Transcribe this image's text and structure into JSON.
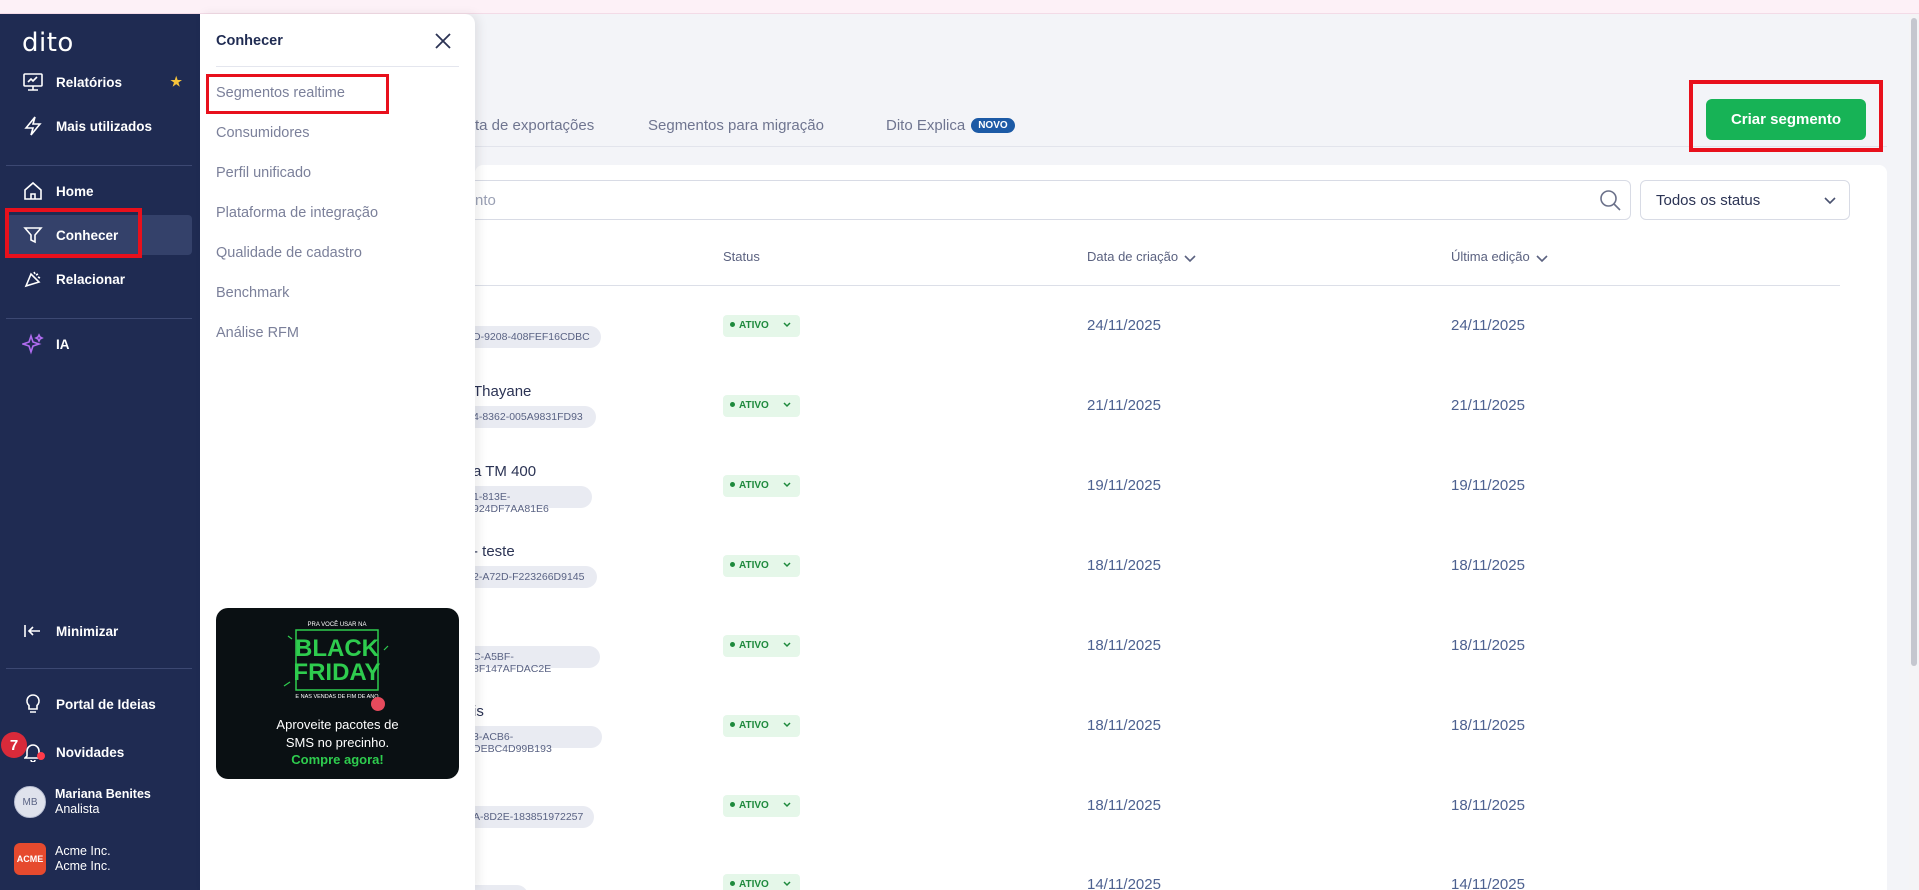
{
  "sidebar": {
    "logo": "dito",
    "items": [
      {
        "label": "Relatórios",
        "icon": "report-icon"
      },
      {
        "label": "Mais utilizados",
        "icon": "lightning-icon"
      },
      {
        "label": "Home",
        "icon": "home-icon"
      },
      {
        "label": "Conhecer",
        "icon": "filter-icon"
      },
      {
        "label": "Relacionar",
        "icon": "megaphone-icon"
      },
      {
        "label": "IA",
        "icon": "sparkles-icon"
      }
    ],
    "bottom": [
      {
        "label": "Minimizar",
        "icon": "collapse-icon"
      },
      {
        "label": "Portal de Ideias",
        "icon": "lightbulb-icon"
      },
      {
        "label": "Novidades",
        "icon": "bell-icon"
      }
    ],
    "notification_count": "7",
    "user": {
      "initials": "MB",
      "name": "Mariana Benites",
      "role": "Analista"
    },
    "account": {
      "logo_text": "ACME",
      "name": "Acme Inc.",
      "sub": "Acme Inc."
    }
  },
  "flyout": {
    "title": "Conhecer",
    "items": [
      "Segmentos realtime",
      "Consumidores",
      "Perfil unificado",
      "Plataforma de integração",
      "Qualidade de cadastro",
      "Benchmark",
      "Análise RFM"
    ],
    "promo": {
      "small": "PRA VOCÊ USAR NA",
      "big1": "BLACK",
      "big2": "FRIDAY",
      "sub": "E NAS VENDAS DE FIM DE ANO",
      "line1": "Aproveite pacotes de",
      "line2": "SMS no precinho.",
      "cta": "Compre agora!"
    }
  },
  "tabs": [
    {
      "label": "ta de exportações"
    },
    {
      "label": "Segmentos para migração"
    },
    {
      "label": "Dito Explica",
      "badge": "NOVO"
    }
  ],
  "create_button": "Criar segmento",
  "search": {
    "placeholder": "nto"
  },
  "status_filter": "Todos os status",
  "table": {
    "headers": {
      "status": "Status",
      "created": "Data de criação",
      "edited": "Última edição"
    },
    "rows": [
      {
        "name": "",
        "id": "D-9208-408FEF16CDBC",
        "status": "ATIVO",
        "created": "24/11/2025",
        "edited": "24/11/2025"
      },
      {
        "name": "Thayane",
        "id": "4-8362-005A9831FD93",
        "status": "ATIVO",
        "created": "21/11/2025",
        "edited": "21/11/2025"
      },
      {
        "name": "a TM 400",
        "id": "1-813E-924DF7AA81E6",
        "status": "ATIVO",
        "created": "19/11/2025",
        "edited": "19/11/2025"
      },
      {
        "name": "- teste",
        "id": "2-A72D-F223266D9145",
        "status": "ATIVO",
        "created": "18/11/2025",
        "edited": "18/11/2025"
      },
      {
        "name": "",
        "id": "C-A5BF-8F147AFDAC2E",
        "status": "ATIVO",
        "created": "18/11/2025",
        "edited": "18/11/2025"
      },
      {
        "name": "is",
        "id": "3-ACB6-DEBC4D99B193",
        "status": "ATIVO",
        "created": "18/11/2025",
        "edited": "18/11/2025"
      },
      {
        "name": "",
        "id": "A-8D2E-183851972257",
        "status": "ATIVO",
        "created": "18/11/2025",
        "edited": "18/11/2025"
      },
      {
        "name": "",
        "id": "",
        "status": "ATIVO",
        "created": "14/11/2025",
        "edited": "14/11/2025"
      }
    ]
  },
  "colors": {
    "sidebar": "#1f2b52",
    "accent_green": "#17b356",
    "highlight_red": "#e8101c"
  }
}
